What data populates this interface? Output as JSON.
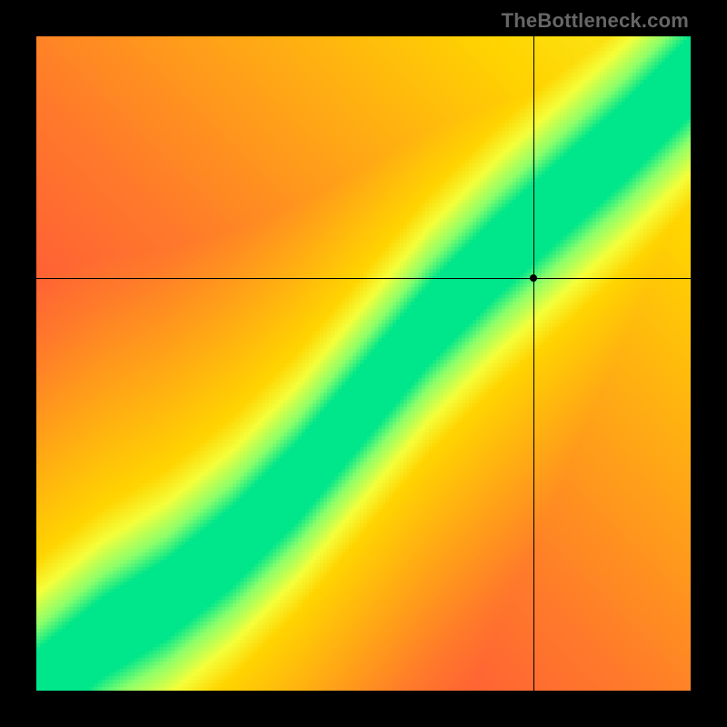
{
  "chart_data": {
    "type": "heatmap",
    "title": "",
    "xlabel": "",
    "ylabel": "",
    "x_range": [
      0,
      100
    ],
    "y_range": [
      0,
      100
    ],
    "colorscale": [
      {
        "t": 0.0,
        "color": "#FF2A4D"
      },
      {
        "t": 0.3,
        "color": "#FF7A2A"
      },
      {
        "t": 0.55,
        "color": "#FFD400"
      },
      {
        "t": 0.72,
        "color": "#F4FF3A"
      },
      {
        "t": 0.88,
        "color": "#8CFF6A"
      },
      {
        "t": 1.0,
        "color": "#00E68A"
      }
    ],
    "ridge_curve": [
      {
        "x": 0,
        "y": 0
      },
      {
        "x": 10,
        "y": 8
      },
      {
        "x": 20,
        "y": 14
      },
      {
        "x": 30,
        "y": 22
      },
      {
        "x": 40,
        "y": 32
      },
      {
        "x": 50,
        "y": 44
      },
      {
        "x": 60,
        "y": 56
      },
      {
        "x": 70,
        "y": 66
      },
      {
        "x": 80,
        "y": 75
      },
      {
        "x": 90,
        "y": 84
      },
      {
        "x": 100,
        "y": 94
      }
    ],
    "ridge_half_width": 6,
    "yellow_halo_width": 14,
    "crosshair": {
      "x": 76,
      "y": 63
    },
    "crosshair_dot_radius": 4,
    "resolution": 180,
    "pixelated": true,
    "frame_color": "#000000"
  },
  "watermark": "TheBottleneck.com"
}
